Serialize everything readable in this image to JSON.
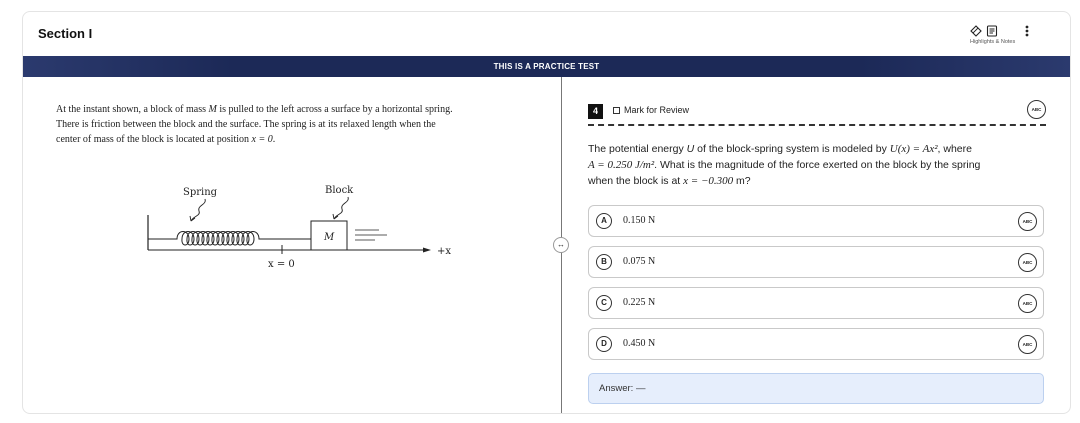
{
  "header": {
    "section_title": "Section I",
    "tools_label": "Highlights & Notes",
    "more_label": "More"
  },
  "banner": {
    "text": "THIS IS A PRACTICE TEST"
  },
  "passage": {
    "line1a": "At the instant shown, a block of mass ",
    "mass_symbol": "M",
    "line1b": " is pulled to the left across a surface by a horizontal spring.",
    "line2": "There is friction between the block and the surface. The spring is at its relaxed length when the",
    "line3a": "center of mass of the block is located at position ",
    "position_eq": "x = 0",
    "line3b": "."
  },
  "figure": {
    "spring_label": "Spring",
    "block_label": "Block",
    "block_mass": "M",
    "axis_label": "+x",
    "origin_label": "x = 0"
  },
  "question": {
    "number": "4",
    "mark_review_label": "Mark for Review",
    "abc_label": "ABC",
    "stem": {
      "p1": "The potential energy ",
      "u": "U",
      "p2": " of the block-spring system is modeled by ",
      "eq1": "U(x) = Ax²",
      "p3": ", where",
      "eq2": "A = 0.250 J/m²",
      "p4": ". What is the magnitude of the force exerted on the block by the spring",
      "p5": "when the block is at ",
      "eq3": "x = −0.300",
      "p6": " m?"
    },
    "choices": [
      {
        "letter": "A",
        "text": "0.150 N"
      },
      {
        "letter": "B",
        "text": "0.075 N"
      },
      {
        "letter": "C",
        "text": "0.225 N"
      },
      {
        "letter": "D",
        "text": "0.450 N"
      }
    ],
    "answer": {
      "label": "Answer:",
      "value": "—"
    }
  },
  "split_handle": "↔"
}
